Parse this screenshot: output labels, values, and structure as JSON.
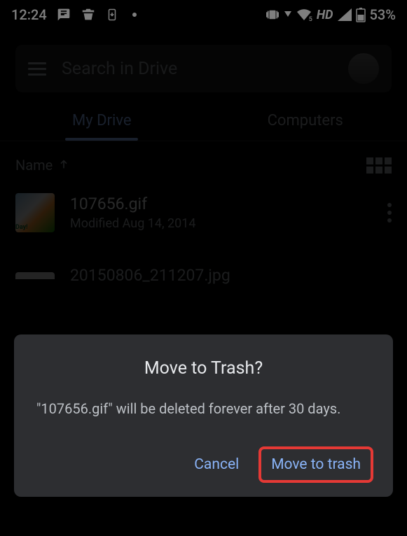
{
  "status": {
    "time": "12:24",
    "hd": "HD",
    "battery": "53%",
    "wifi_badge": "5"
  },
  "search": {
    "placeholder": "Search in Drive"
  },
  "tabs": {
    "mydrive": "My Drive",
    "computers": "Computers"
  },
  "list": {
    "sort_label": "Name",
    "files": [
      {
        "name": "107656.gif",
        "meta": "Modified Aug 14, 2014",
        "thumb_text": "Day!"
      },
      {
        "name": "20150806_211207.jpg",
        "meta": ""
      }
    ]
  },
  "dialog": {
    "title": "Move to Trash?",
    "body": "\"107656.gif\" will be deleted forever after 30 days.",
    "cancel": "Cancel",
    "confirm": "Move to trash"
  }
}
